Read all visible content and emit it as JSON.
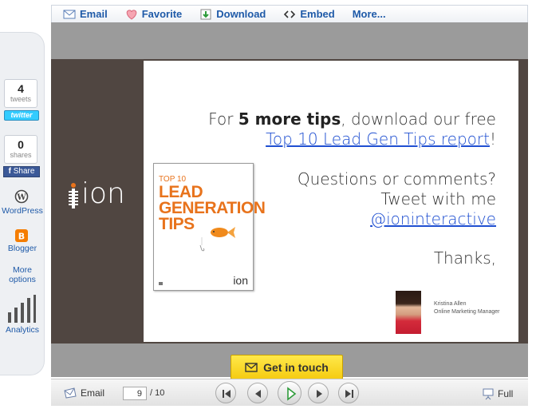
{
  "toolbar": {
    "email_label": "Email",
    "favorite_label": "Favorite",
    "download_label": "Download",
    "embed_label": "Embed",
    "more_label": "More..."
  },
  "share_panel": {
    "tweets_count": "4",
    "tweets_label": "tweets",
    "twitter_button": "twitter",
    "shares_count": "0",
    "shares_label": "shares",
    "facebook_button": "Share",
    "wordpress_label": "WordPress",
    "blogger_label": "Blogger",
    "more_options_line1": "More",
    "more_options_line2": "options",
    "analytics_label": "Analytics"
  },
  "slide": {
    "logo_text": "ion",
    "line1_pre": "For ",
    "line1_bold": "5 more tips",
    "line1_post": ", download our free",
    "line2_link": "Top 10 Lead Gen Tips report",
    "line2_post": "!",
    "question": "Questions or comments?",
    "tweet": "Tweet with me",
    "handle": "@ioninteractive",
    "thanks": "Thanks,",
    "author_name": "Kristina Allen",
    "author_title": "Online Marketing Manager",
    "book_small": "TOP 10",
    "book_line1": "LEAD",
    "book_line2": "GENERATION",
    "book_line3": "TIPS",
    "book_logo": "ion"
  },
  "cta": {
    "label": "Get in touch"
  },
  "controls": {
    "email_label": "Email",
    "page_current": "9",
    "page_total": "/ 10",
    "full_label": "Full"
  },
  "colors": {
    "link_blue": "#1f5aa8",
    "slide_brown": "#504641",
    "book_orange": "#e8731c",
    "cta_yellow": "#f5cc12"
  }
}
